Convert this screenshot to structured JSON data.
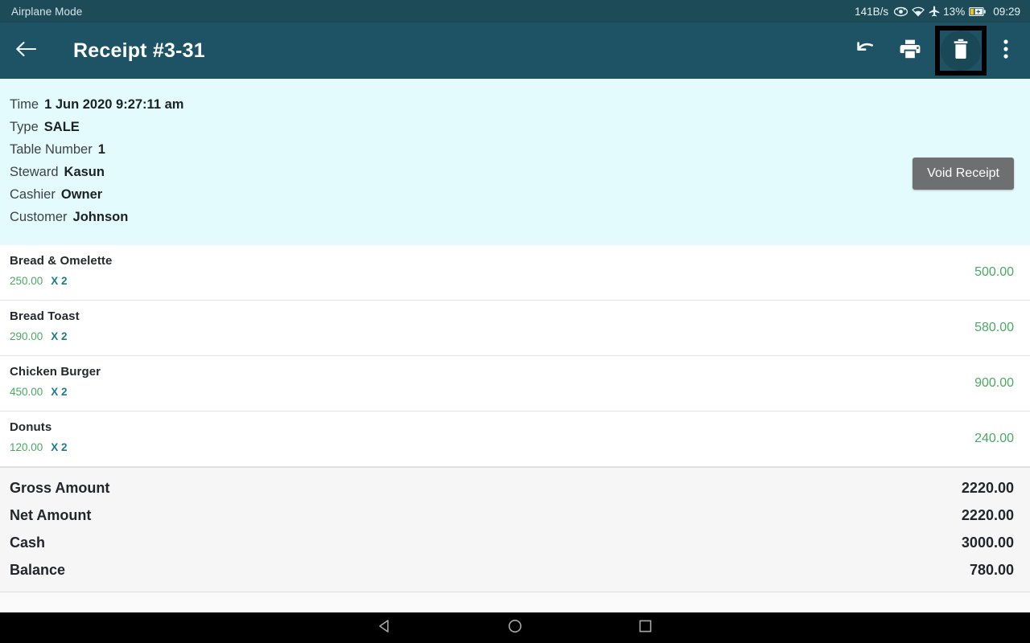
{
  "status_bar": {
    "left_text": "Airplane Mode",
    "network_speed": "141B/s",
    "icons": [
      "eye-icon",
      "wifi-icon",
      "airplane-icon"
    ],
    "battery_percent": "13%",
    "battery_icon": "battery-charging-icon",
    "clock": "09:29"
  },
  "toolbar": {
    "back_icon": "back-arrow-icon",
    "title": "Receipt #3-31",
    "actions": [
      {
        "name": "undo",
        "icon": "undo-icon",
        "label": "Undo"
      },
      {
        "name": "print",
        "icon": "printer-icon",
        "label": "Print"
      },
      {
        "name": "delete",
        "icon": "trash-icon",
        "label": "Delete",
        "focused": true
      },
      {
        "name": "more",
        "icon": "overflow-menu-icon",
        "label": "More options"
      }
    ]
  },
  "info": {
    "rows": [
      {
        "label": "Time",
        "value": "1 Jun 2020 9:27:11 am"
      },
      {
        "label": "Type",
        "value": "SALE"
      },
      {
        "label": "Table Number",
        "value": "1"
      },
      {
        "label": "Steward",
        "value": "Kasun"
      },
      {
        "label": "Cashier",
        "value": "Owner"
      },
      {
        "label": "Customer",
        "value": "Johnson"
      }
    ],
    "void_button": "Void Receipt"
  },
  "items": [
    {
      "name": "Bread & Omelette",
      "price": "250.00",
      "qty": "X 2",
      "total": "500.00"
    },
    {
      "name": "Bread Toast",
      "price": "290.00",
      "qty": "X 2",
      "total": "580.00"
    },
    {
      "name": "Chicken Burger",
      "price": "450.00",
      "qty": "X 2",
      "total": "900.00"
    },
    {
      "name": "Donuts",
      "price": "120.00",
      "qty": "X 2",
      "total": "240.00"
    }
  ],
  "summary": [
    {
      "label": "Gross Amount",
      "value": "2220.00"
    },
    {
      "label": "Net Amount",
      "value": "2220.00"
    },
    {
      "label": "Cash",
      "value": "3000.00"
    },
    {
      "label": "Balance",
      "value": "780.00"
    }
  ],
  "nav_bar": {
    "back_icon": "nav-back-icon",
    "home_icon": "nav-home-icon",
    "recents_icon": "nav-recents-icon"
  },
  "colors": {
    "toolbar": "#1d5364",
    "status_bar": "#1d4b57",
    "info_panel": "#e4fbfd",
    "price_green": "#4aa862",
    "qty_teal": "#1f7a8c",
    "void_gray": "#6d6f70"
  }
}
